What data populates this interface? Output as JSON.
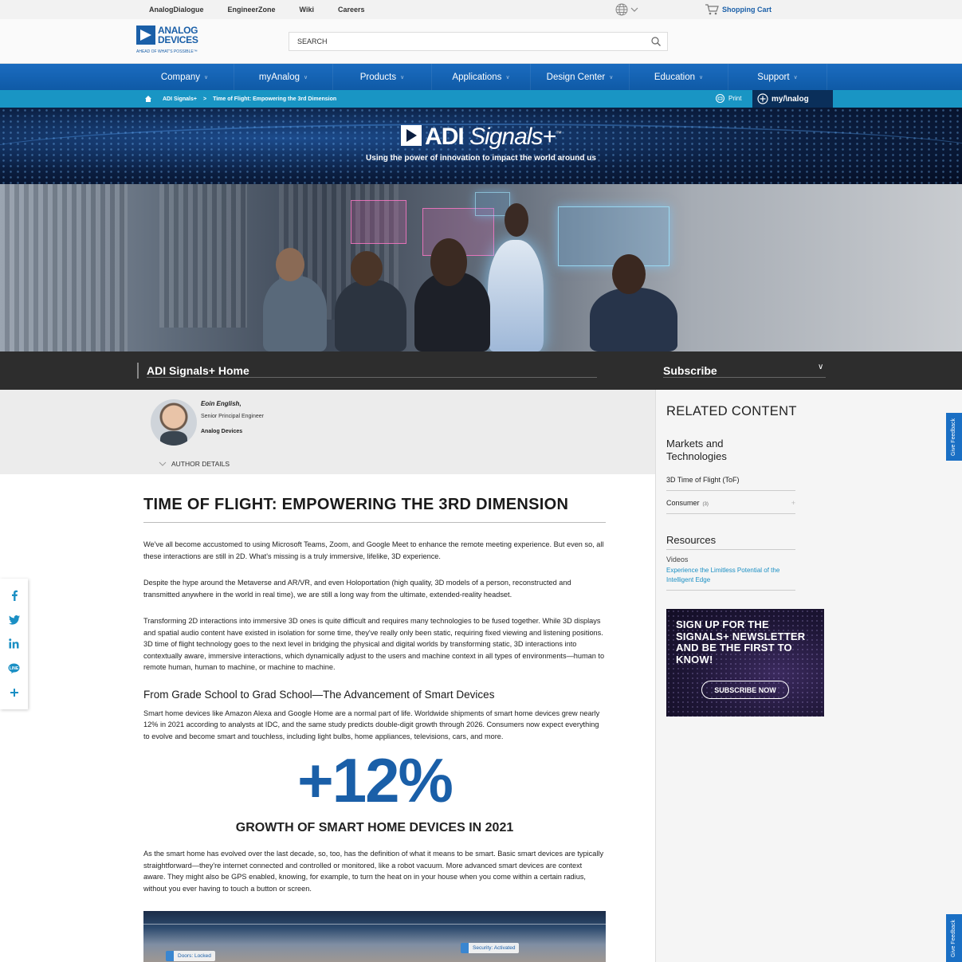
{
  "utility": {
    "links": [
      "AnalogDialogue",
      "EngineerZone",
      "Wiki",
      "Careers"
    ],
    "cart_label": "Shopping Cart"
  },
  "header": {
    "logo_line1": "ANALOG",
    "logo_line2": "DEVICES",
    "logo_tagline": "AHEAD OF WHAT'S POSSIBLE™",
    "search_placeholder": "SEARCH"
  },
  "nav": {
    "items": [
      "Company",
      "myAnalog",
      "Products",
      "Applications",
      "Design Center",
      "Education",
      "Support"
    ]
  },
  "breadcrumb": {
    "home_icon": "home-icon",
    "items": [
      "ADI Signals+",
      "Time of Flight: Empowering the 3rd Dimension"
    ],
    "separator": ">",
    "print_label": "Print",
    "myanalog_label": "my/\\nalog"
  },
  "banner": {
    "title_adi": "ADI",
    "title_signals": "Signals+",
    "title_tm": "™",
    "subtitle": "Using the power of innovation to impact the world around us"
  },
  "subnav": {
    "home_label": "ADI Signals+ Home",
    "subscribe_label": "Subscribe"
  },
  "author": {
    "name": "Eoin English,",
    "role": "Senior Principal Engineer",
    "org": "Analog Devices",
    "details_label": "AUTHOR DETAILS"
  },
  "article": {
    "title": "TIME OF FLIGHT: EMPOWERING THE 3RD DIMENSION",
    "p1": "We've all become accustomed to using Microsoft Teams, Zoom, and Google Meet to enhance the remote meeting experience. But even so, all these interactions are still in 2D. What's missing is a truly immersive, lifelike, 3D experience.",
    "p2": "Despite the hype around the Metaverse and AR/VR, and even Holoportation (high quality, 3D models of a person, reconstructed and transmitted anywhere in the world in real time), we are still a long way from the ultimate, extended-reality headset.",
    "p3": "Transforming 2D interactions into immersive 3D ones is quite difficult and requires many technologies to be fused together. While 3D displays and spatial audio content have existed in isolation for some time, they've really only been static, requiring fixed viewing and listening positions. 3D time of flight technology goes to the next level in bridging the physical and digital worlds by transforming static, 3D interactions into contextually aware, immersive interactions, which dynamically adjust to the users and machine context in all types of environments—human to remote human, human to machine, or machine to machine.",
    "h2": "From Grade School to Grad School—The Advancement of Smart Devices",
    "p4": "Smart home devices like Amazon Alexa and Google Home are a normal part of life. Worldwide shipments of smart home devices grew nearly 12% in 2021 according to analysts at IDC, and the same study predicts double-digit growth through 2026. Consumers now expect everything to evolve and become smart and touchless, including light bulbs, home appliances, televisions, cars, and more.",
    "stat_value": "+12%",
    "stat_caption": "GROWTH OF SMART HOME DEVICES IN 2021",
    "p5": "As the smart home has evolved over the last decade, so, too, has the definition of what it means to be smart. Basic smart devices are typically straightforward—they're internet connected and controlled or monitored, like a robot vacuum. More advanced smart devices are context aware. They might also be GPS enabled, knowing, for example, to turn the heat on in your house when you come within a certain radius, without you ever having to touch a button or screen.",
    "image_labels": [
      "Doors: Locked",
      "Security: Activated"
    ]
  },
  "sidebar": {
    "related_title": "RELATED CONTENT",
    "markets_title": "Markets and Technologies",
    "link1": "3D Time of Flight (ToF)",
    "link2": "Consumer",
    "link2_count": "(3)",
    "resources_title": "Resources",
    "videos_label": "Videos",
    "video_link": "Experience the Limitless Potential of the Intelligent Edge",
    "promo_text": "SIGN UP FOR THE SIGNALS+ NEWSLETTER AND BE THE FIRST TO KNOW!",
    "promo_button": "SUBSCRIBE NOW"
  },
  "share": {
    "icons": [
      "facebook-icon",
      "twitter-icon",
      "linkedin-icon",
      "line-icon",
      "plus-icon"
    ]
  },
  "feedback_label": "Give Feedback",
  "colors": {
    "brand_blue": "#1a5fa8",
    "nav_blue": "#1b6cc0",
    "crumb_cyan": "#1995c4",
    "dark_bar": "#2d2d2d",
    "link_cyan": "#1a8fc4"
  }
}
